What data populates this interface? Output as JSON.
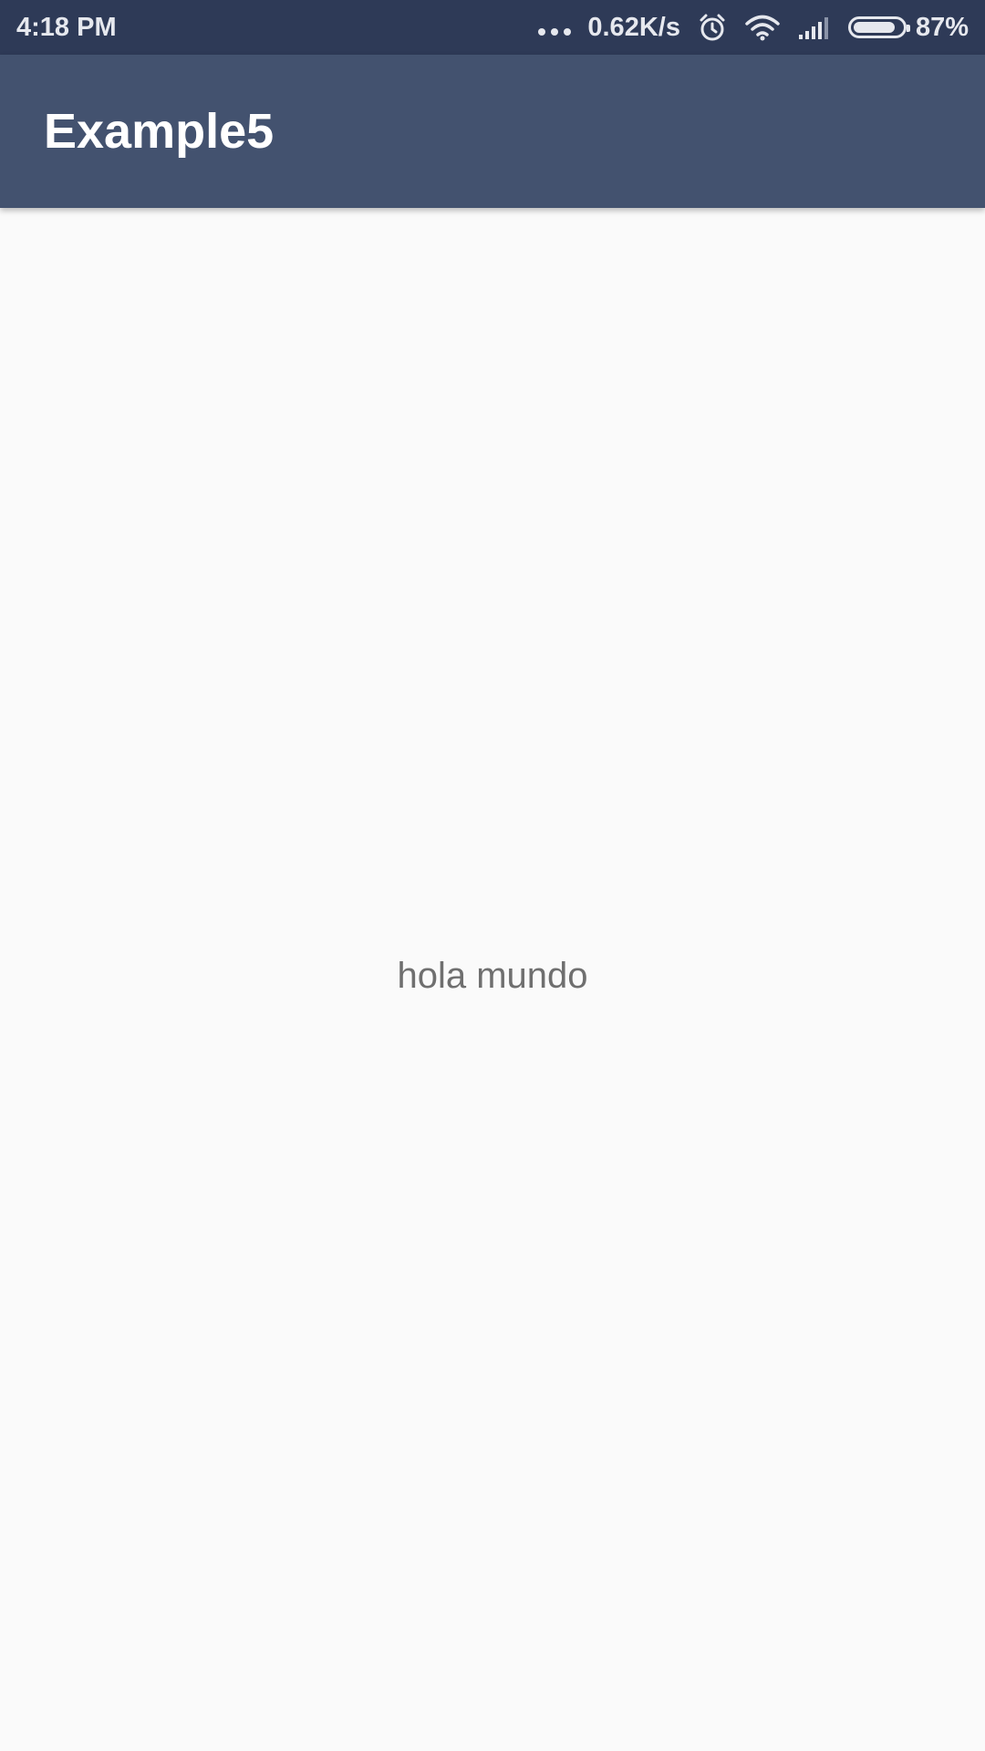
{
  "status_bar": {
    "time": "4:18 PM",
    "network_speed": "0.62K/s",
    "battery_percent_label": "87%",
    "battery_level": 0.87,
    "icons": [
      "more-dots-icon",
      "alarm-icon",
      "wifi-icon",
      "signal-icon",
      "battery-icon"
    ]
  },
  "app_bar": {
    "title": "Example5"
  },
  "main": {
    "text": "hola mundo"
  },
  "colors": {
    "status_bar_bg": "#2e3a57",
    "app_bar_bg": "#43526f",
    "background": "#fafafa",
    "body_text": "#6f6f6f"
  }
}
